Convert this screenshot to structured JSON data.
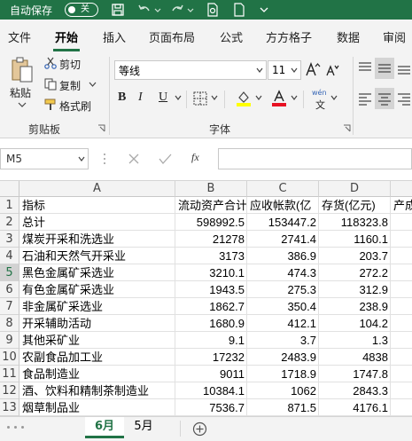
{
  "titlebar": {
    "autosave_label": "自动保存",
    "toggle_state": "关"
  },
  "tabs": [
    {
      "label": "文件"
    },
    {
      "label": "开始"
    },
    {
      "label": "插入"
    },
    {
      "label": "页面布局"
    },
    {
      "label": "公式"
    },
    {
      "label": "方方格子"
    },
    {
      "label": "数据"
    },
    {
      "label": "审阅"
    }
  ],
  "ribbon": {
    "paste": "粘贴",
    "cut": "剪切",
    "copy": "复制",
    "format_painter": "格式刷",
    "clipboard_group": "剪贴板",
    "font_name": "等线",
    "font_size": "11",
    "bold": "B",
    "italic": "I",
    "underline": "U",
    "font_group": "字体",
    "wen": "wén",
    "wen2": "文"
  },
  "formula": {
    "namebox": "M5",
    "fx": "fx",
    "content": ""
  },
  "columns": [
    "A",
    "B",
    "C",
    "D"
  ],
  "rows": [
    {
      "n": "1",
      "a": "指标",
      "b": "流动资产合计",
      "c": "应收帐款(亿",
      "d": "存货(亿元)",
      "e": "产成"
    },
    {
      "n": "2",
      "a": "总计",
      "b": "598992.5",
      "c": "153447.2",
      "d": "118323.8"
    },
    {
      "n": "3",
      "a": "煤炭开采和洗选业",
      "b": "21278",
      "c": "2741.4",
      "d": "1160.1"
    },
    {
      "n": "4",
      "a": "石油和天然气开采业",
      "b": "3173",
      "c": "386.9",
      "d": "203.7"
    },
    {
      "n": "5",
      "a": "黑色金属矿采选业",
      "b": "3210.1",
      "c": "474.3",
      "d": "272.2"
    },
    {
      "n": "6",
      "a": "有色金属矿采选业",
      "b": "1943.5",
      "c": "275.3",
      "d": "312.9"
    },
    {
      "n": "7",
      "a": "非金属矿采选业",
      "b": "1862.7",
      "c": "350.4",
      "d": "238.9"
    },
    {
      "n": "8",
      "a": "开采辅助活动",
      "b": "1680.9",
      "c": "412.1",
      "d": "104.2"
    },
    {
      "n": "9",
      "a": "其他采矿业",
      "b": "9.1",
      "c": "3.7",
      "d": "1.3"
    },
    {
      "n": "10",
      "a": "农副食品加工业",
      "b": "17232",
      "c": "2483.9",
      "d": "4838"
    },
    {
      "n": "11",
      "a": "食品制造业",
      "b": "9011",
      "c": "1718.9",
      "d": "1747.8"
    },
    {
      "n": "12",
      "a": "酒、饮料和精制茶制造业",
      "b": "10384.1",
      "c": "1062",
      "d": "2843.3"
    },
    {
      "n": "13",
      "a": "烟草制品业",
      "b": "7536.7",
      "c": "871.5",
      "d": "4176.1"
    }
  ],
  "sheets": [
    {
      "label": "6月"
    },
    {
      "label": "5月"
    }
  ],
  "colors": {
    "accent": "#217346",
    "underline_red": "#e81123",
    "highlight_yellow": "#ffff00"
  }
}
